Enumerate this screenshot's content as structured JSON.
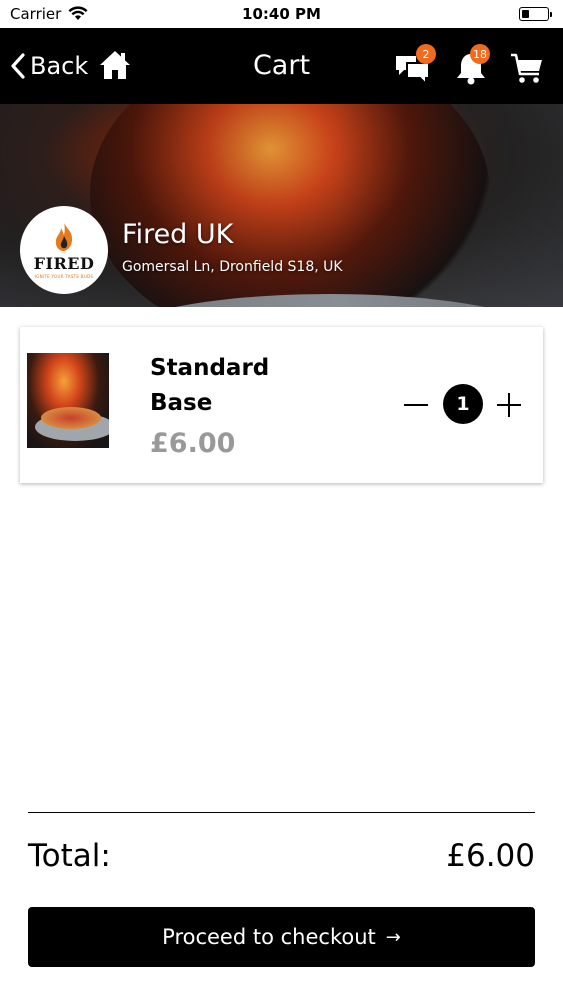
{
  "status_bar": {
    "carrier": "Carrier",
    "time": "10:40 PM",
    "battery_level": 0.3
  },
  "nav": {
    "back_label": "Back",
    "title": "Cart",
    "chat_badge": "2",
    "notifications_badge": "18"
  },
  "restaurant": {
    "logo_text": "FIRED",
    "logo_tagline": "IGNITE YOUR TASTE BUDS",
    "name": "Fired UK",
    "address": "Gomersal Ln, Dronfield S18, UK"
  },
  "cart": {
    "items": [
      {
        "name": "Standard Base",
        "price": "£6.00",
        "quantity": "1"
      }
    ]
  },
  "summary": {
    "total_label": "Total:",
    "total_value": "£6.00"
  },
  "checkout": {
    "label": "Proceed to checkout",
    "arrow": "→"
  },
  "colors": {
    "nav_bg": "#000000",
    "badge": "#f26b1d",
    "price_gray": "#999999"
  }
}
